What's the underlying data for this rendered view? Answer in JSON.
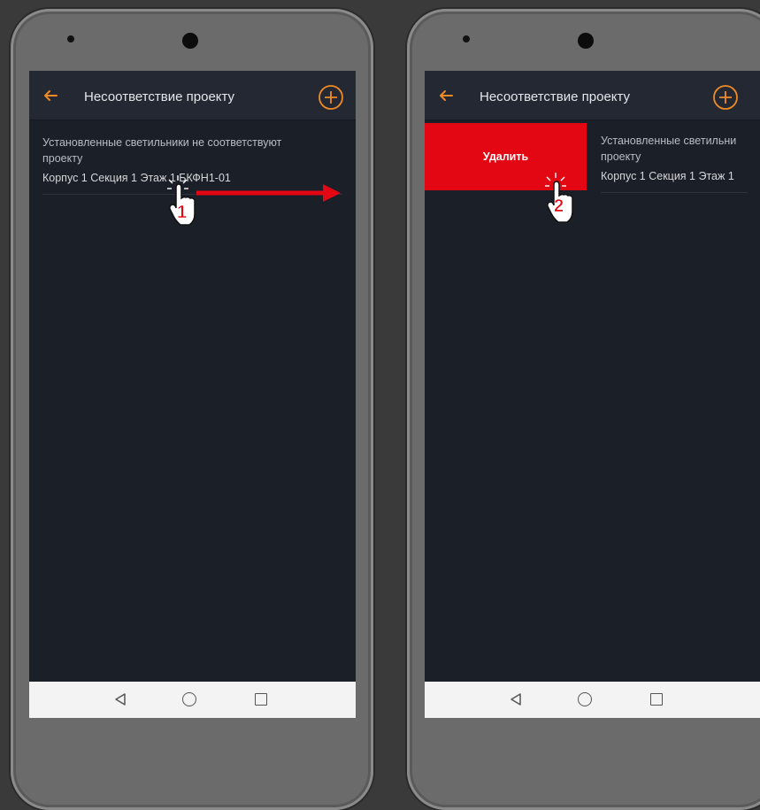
{
  "screens": [
    {
      "app_bar": {
        "title": "Несоответствие проекту"
      },
      "icons": {
        "back": "arrow-left-icon",
        "add": "plus-circle-icon"
      },
      "list_item": {
        "line1": "Установленные светильники не соответствуют",
        "line2": "проекту",
        "line3": "Корпус 1 Секция 1 Этаж 1 БКФН1-01"
      },
      "step_marker": "1"
    },
    {
      "app_bar": {
        "title": "Несоответствие проекту"
      },
      "icons": {
        "back": "arrow-left-icon",
        "add": "plus-circle-icon"
      },
      "delete_label": "Удалить",
      "list_item": {
        "line1": "Установленные светильни",
        "line2": "проекту",
        "line3": "Корпус 1 Секция 1 Этаж 1"
      },
      "step_marker": "2"
    }
  ],
  "colors": {
    "accent": "#f08a24",
    "delete": "#e30613",
    "screen_bg": "#1b1f27",
    "app_bar_bg": "#232833",
    "swipe_arrow": "#e30613"
  },
  "nav_icons": [
    "triangle-back-icon",
    "circle-home-icon",
    "square-recents-icon"
  ]
}
